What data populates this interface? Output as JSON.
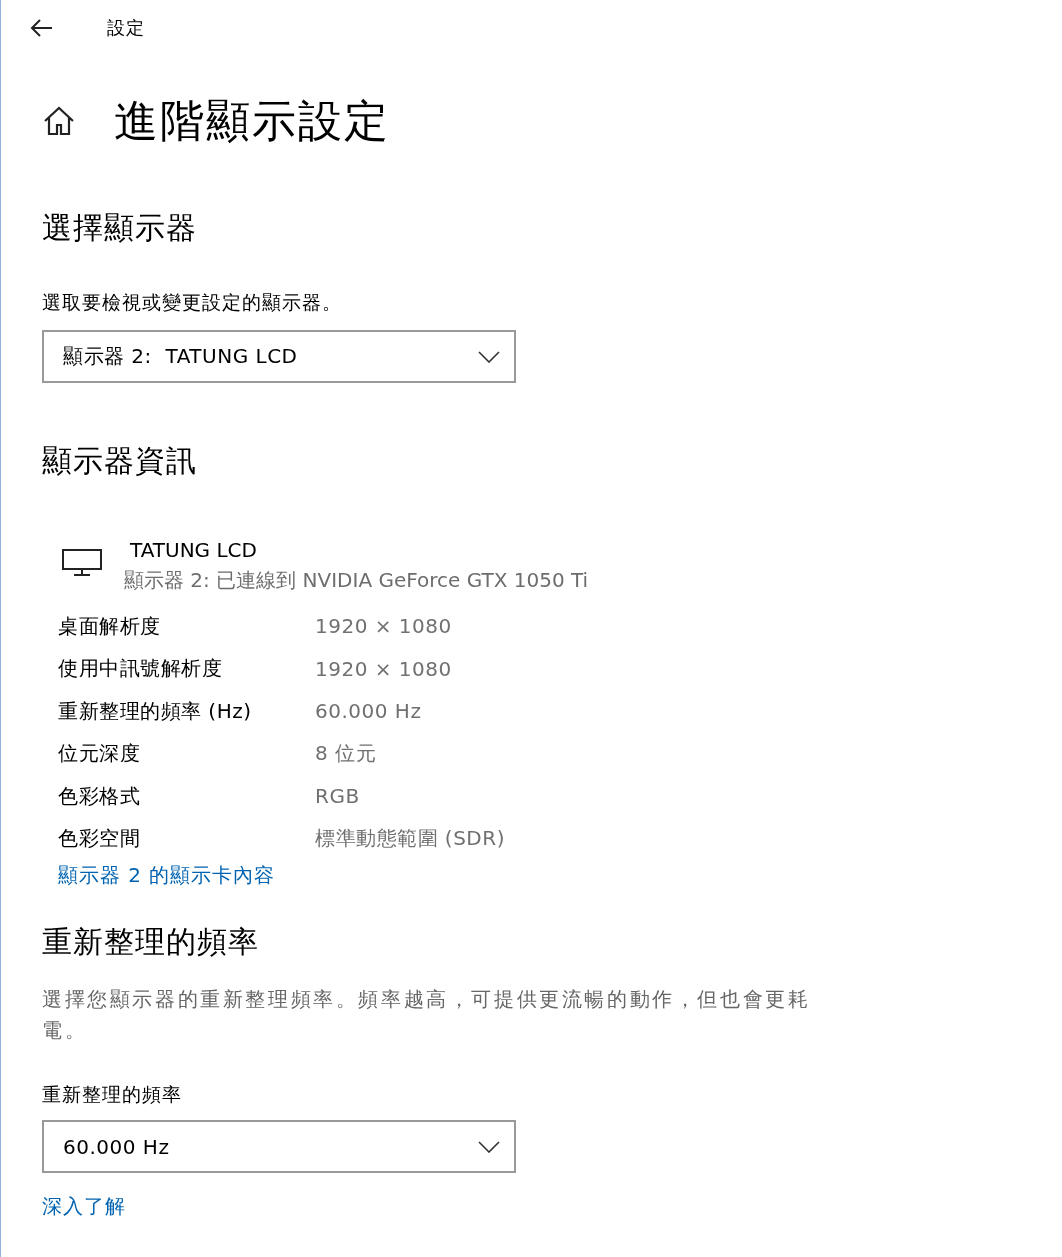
{
  "window": {
    "title": "設定"
  },
  "page": {
    "title": "進階顯示設定"
  },
  "select_display": {
    "heading": "選擇顯示器",
    "label": "選取要檢視或變更設定的顯示器。",
    "dropdown": {
      "value": "顯示器 2:  TATUNG LCD"
    }
  },
  "display_info": {
    "heading": "顯示器資訊",
    "monitor_name": "TATUNG LCD",
    "monitor_detail": "顯示器 2: 已連線到 NVIDIA GeForce GTX 1050 Ti",
    "rows": [
      {
        "label": "桌面解析度",
        "value": "1920 × 1080"
      },
      {
        "label": "使用中訊號解析度",
        "value": "1920 × 1080"
      },
      {
        "label": "重新整理的頻率 (Hz)",
        "value": "60.000 Hz"
      },
      {
        "label": "位元深度",
        "value": "8 位元"
      },
      {
        "label": "色彩格式",
        "value": "RGB"
      },
      {
        "label": "色彩空間",
        "value": "標準動態範圍 (SDR)"
      }
    ],
    "link": "顯示器 2 的顯示卡內容"
  },
  "refresh_rate": {
    "heading": "重新整理的頻率",
    "description": "選擇您顯示器的重新整理頻率。頻率越高，可提供更流暢的動作，但也會更耗電。",
    "label": "重新整理的頻率",
    "dropdown": {
      "value": "60.000 Hz"
    },
    "link": "深入了解"
  }
}
